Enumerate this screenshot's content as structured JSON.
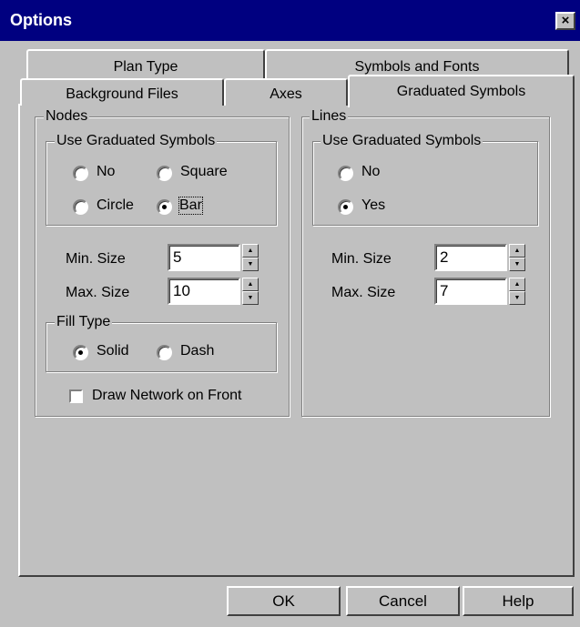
{
  "window": {
    "title": "Options",
    "close_glyph": "×"
  },
  "tabs": {
    "row_back": [
      "Plan Type",
      "Symbols and Fonts"
    ],
    "row_front": [
      "Background Files",
      "Axes"
    ],
    "active": "Graduated Symbols"
  },
  "nodes": {
    "group_label": "Nodes",
    "use_graduated": {
      "label": "Use Graduated Symbols",
      "options": [
        "No",
        "Square",
        "Circle",
        "Bar"
      ],
      "selected": "Bar"
    },
    "min_size": {
      "label": "Min. Size",
      "value": "5"
    },
    "max_size": {
      "label": "Max. Size",
      "value": "10"
    },
    "fill_type": {
      "label": "Fill Type",
      "options": [
        "Solid",
        "Dash"
      ],
      "selected": "Solid"
    },
    "draw_front": {
      "label": "Draw Network on Front",
      "checked": false
    }
  },
  "lines": {
    "group_label": "Lines",
    "use_graduated": {
      "label": "Use Graduated Symbols",
      "options": [
        "No",
        "Yes"
      ],
      "selected": "Yes"
    },
    "min_size": {
      "label": "Min. Size",
      "value": "2"
    },
    "max_size": {
      "label": "Max. Size",
      "value": "7"
    }
  },
  "buttons": {
    "ok": "OK",
    "cancel": "Cancel",
    "help": "Help"
  },
  "colors": {
    "titlebar": "#000080",
    "face": "#c0c0c0"
  }
}
